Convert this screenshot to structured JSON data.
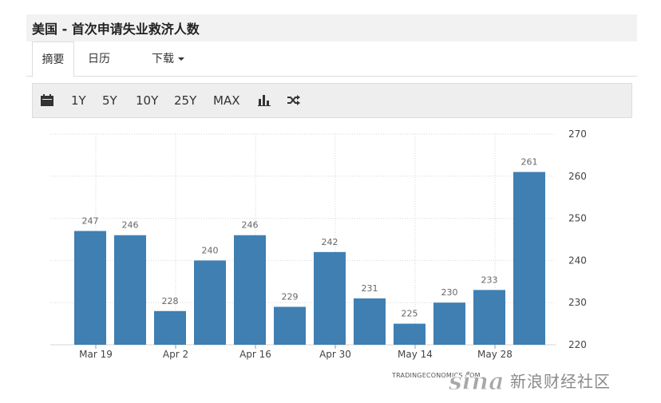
{
  "title": "美国 - 首次申请失业救济人数",
  "tabs": [
    {
      "label": "摘要",
      "active": true
    },
    {
      "label": "日历",
      "active": false
    },
    {
      "label": "下载",
      "active": false
    }
  ],
  "toolbar": {
    "ranges": [
      "1Y",
      "5Y",
      "10Y",
      "25Y",
      "MAX"
    ],
    "icons": [
      "calendar-icon",
      "bar-chart-icon",
      "shuffle-icon"
    ]
  },
  "colors": {
    "bar": "#3f7fb2",
    "grid": "#d6d6d6"
  },
  "chart_data": {
    "type": "bar",
    "values": [
      247,
      246,
      228,
      240,
      246,
      229,
      242,
      231,
      225,
      230,
      233,
      261
    ],
    "x_tick_labels": [
      "Mar 19",
      "Apr 2",
      "Apr 16",
      "Apr 30",
      "May 14",
      "May 28"
    ],
    "y_ticks": [
      220,
      230,
      240,
      250,
      260,
      270
    ],
    "ylim": [
      220,
      270
    ],
    "y_axis_side": "right",
    "grid": true,
    "data_labels": true
  },
  "source": "TRADINGECONOMICS.COM",
  "watermark": {
    "logo": "sina",
    "text": "新浪财经社区"
  }
}
